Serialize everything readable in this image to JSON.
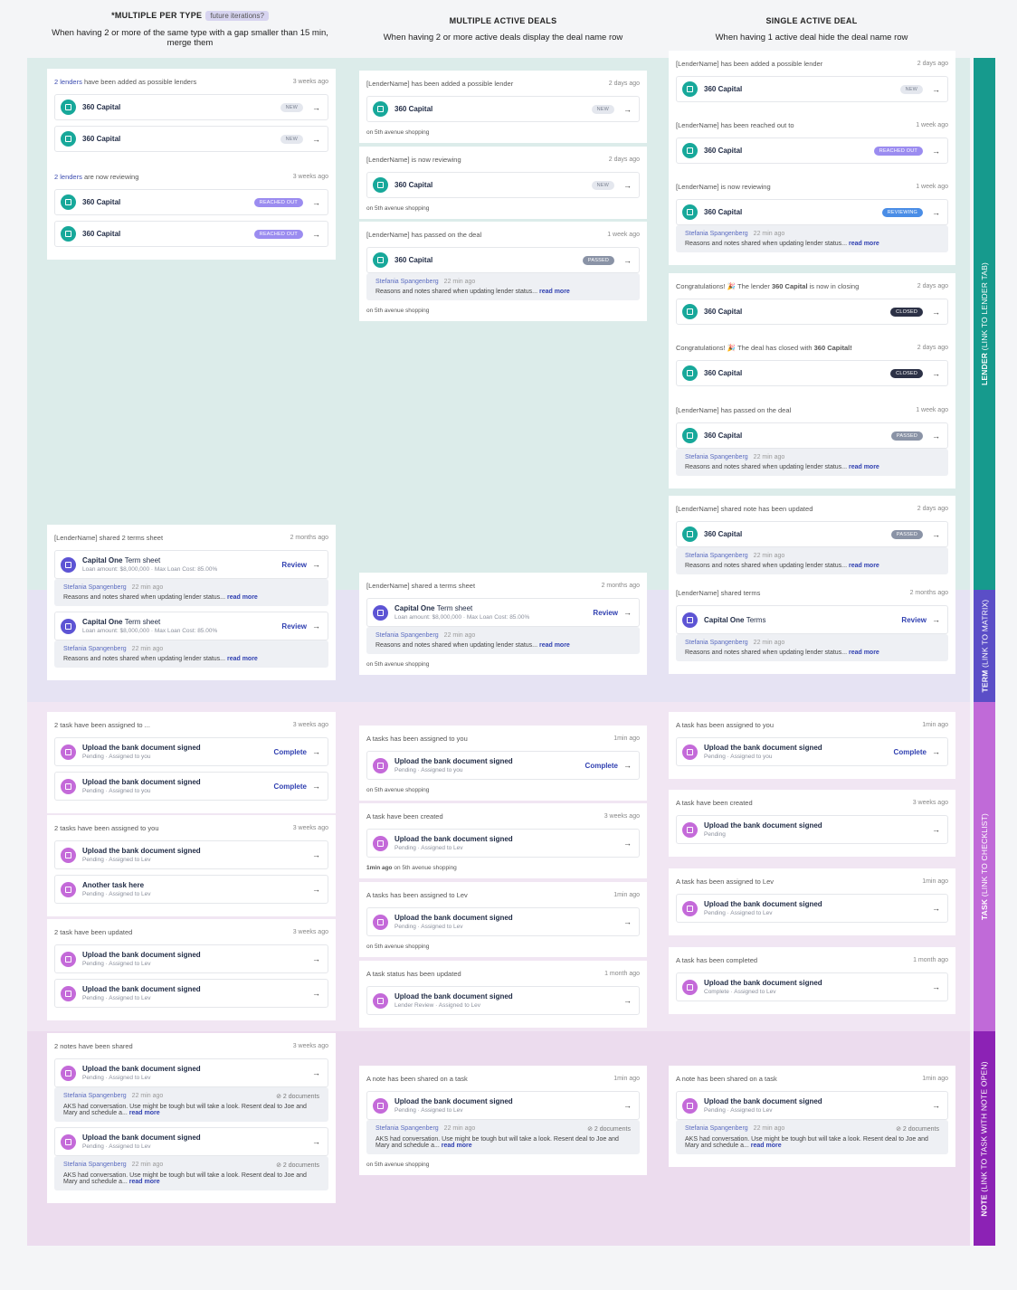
{
  "colors": {
    "lender_band": "#dcecea",
    "term_band": "#e6e3f3",
    "task_band": "#f1e6f3",
    "note_band": "#ecdcee",
    "lender_bar": "#169a8d",
    "term_bar": "#5b4ec7",
    "task_bar": "#c06ad8",
    "note_bar": "#8c22b5"
  },
  "columns": {
    "c1": {
      "title": "*MULTIPLE PER TYPE",
      "tag": "future iterations?",
      "desc": "When having 2 or more of the same type with a gap smaller than 15 min, merge them"
    },
    "c2": {
      "title": "MULTIPLE ACTIVE DEALS",
      "desc": "When having 2 or more active deals display the deal name row"
    },
    "c3": {
      "title": "SINGLE ACTIVE DEAL",
      "desc": "When having 1 active deal hide the deal name row"
    }
  },
  "side": {
    "lender": {
      "b": "LENDER",
      "r": " (LINK TO LENDER TAB)"
    },
    "term": {
      "b": "TERM",
      "r": " (LINK TO MATRIX)"
    },
    "task": {
      "b": "TASK",
      "r": " (LINK TO CHECKLIST)"
    },
    "note": {
      "b": "NOTE",
      "r": " (LINK TO TASK WITH NOTE OPEN)"
    }
  },
  "common": {
    "lender": "360 Capital",
    "arrow": "→",
    "deal": "on 5th avenue shopping",
    "who": "Stefania Spangenberg",
    "when": "22 min ago",
    "reason": "Reasons and notes shared when updating lender status...",
    "readmore": "read more",
    "aks": "AKS had conversation. Use might be tough but will take a look. Resent deal to Joe and Mary and schedule a...",
    "docs": "2 documents",
    "task": "Upload the bank document signed",
    "task2": "Another task here",
    "pending": "Pending",
    "assigned_you": "Assigned to you",
    "assigned_lev": "Assigned to Lev",
    "complete_st": "Complete",
    "lender_review": "Lender Review",
    "complete": "Complete",
    "review": "Review",
    "co": "Capital One",
    "termsheet": "Term sheet",
    "terms": "Terms",
    "loan": "Loan amount: $8,000,000 · Max Loan Cost: 85.00%",
    "b_new": "NEW",
    "b_reached": "REACHED OUT",
    "b_reviewing": "REVIEWING",
    "b_closed": "CLOSED",
    "b_passed": "PASSED"
  },
  "g": {
    "c1l1": {
      "hl": "2 lenders",
      "h": " have been added as possible lenders",
      "t": "3 weeks ago"
    },
    "c1l2": {
      "hl": "2 lenders",
      "h": " are now reviewing",
      "t": "3 weeks ago"
    },
    "c1t1": {
      "h": "[LenderName] shared 2 terms sheet",
      "t": "2 months ago"
    },
    "c1k1": {
      "h": "2 task have been assigned to ...",
      "t": "3 weeks ago"
    },
    "c1k2": {
      "h": "2 tasks have been assigned to you",
      "t": "3 weeks ago"
    },
    "c1k3": {
      "h": "2 task have been updated",
      "t": "3 weeks ago"
    },
    "c1n1": {
      "h": "2 notes have been shared",
      "t": "3 weeks ago"
    },
    "c2l1": {
      "h": "[LenderName] has been added a possible lender",
      "t": "2 days ago"
    },
    "c2l2": {
      "h": "[LenderName] is now reviewing",
      "t": "2 days ago"
    },
    "c2l3": {
      "h": "[LenderName] has passed on the deal",
      "t": "1 week ago"
    },
    "c2t1": {
      "h": "[LenderName] shared a terms sheet",
      "t": "2 months ago"
    },
    "c2k1": {
      "h": "A tasks has been assigned to you",
      "t": "1min ago"
    },
    "c2k2": {
      "h": "A task have been created",
      "t": "3 weeks ago",
      "deal_pre": "1min ago"
    },
    "c2k3": {
      "h": "A tasks has been assigned to Lev",
      "t": "1min ago"
    },
    "c2k4": {
      "h": "A task status has been updated",
      "t": "1 month ago"
    },
    "c2n1": {
      "h": "A note has been shared on a task",
      "t": "1min ago"
    },
    "c3l1": {
      "h": "[LenderName] has been added a possible lender",
      "t": "2 days ago"
    },
    "c3l2": {
      "h": "[LenderName] has been reached out to",
      "t": "1 week ago"
    },
    "c3l3": {
      "h": "[LenderName] is now reviewing",
      "t": "1 week ago"
    },
    "c3l4": {
      "h1": "Congratulations! 🎉 The lender ",
      "hb": "360 Capital",
      "h2": " is now in closing",
      "t": "2 days ago"
    },
    "c3l5": {
      "h1": "Congratulations! 🎉 The deal has closed with ",
      "hb": "360 Capital!",
      "t": "2 days ago"
    },
    "c3l6": {
      "h": "[LenderName] has passed on the deal",
      "t": "1 week ago"
    },
    "c3l7": {
      "h": "[LenderName] shared note has been updated",
      "t": "2 days ago"
    },
    "c3t1": {
      "h": "[LenderName] shared terms",
      "t": "2 months ago"
    },
    "c3k1": {
      "h": "A task has been assigned to you",
      "t": "1min ago"
    },
    "c3k2": {
      "h": "A task have been created",
      "t": "3 weeks ago"
    },
    "c3k3": {
      "h": "A task has been assigned to Lev",
      "t": "1min ago"
    },
    "c3k4": {
      "h": "A task has been completed",
      "t": "1 month ago"
    },
    "c3n1": {
      "h": "A note has been shared on a task",
      "t": "1min ago"
    }
  }
}
